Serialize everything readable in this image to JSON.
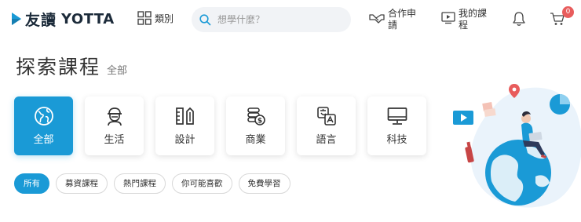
{
  "header": {
    "logo_cn": "友讀",
    "logo_en": "YOTTA",
    "category_label": "類別",
    "search_placeholder": "想學什麼？",
    "nav": {
      "cooperate": "合作申請",
      "my_courses": "我的課程"
    },
    "cart_count": "0"
  },
  "page": {
    "title": "探索課程",
    "subtitle": "全部"
  },
  "categories": [
    {
      "label": "全部",
      "icon": "globe-icon"
    },
    {
      "label": "生活",
      "icon": "person-icon"
    },
    {
      "label": "設計",
      "icon": "ruler-pencil-icon"
    },
    {
      "label": "商業",
      "icon": "coins-icon"
    },
    {
      "label": "語言",
      "icon": "translate-icon"
    },
    {
      "label": "科技",
      "icon": "monitor-icon"
    }
  ],
  "filters": [
    "所有",
    "募資課程",
    "熱門課程",
    "你可能喜歡",
    "免費學習"
  ],
  "colors": {
    "accent": "#1a9ad6",
    "badge": "#e85c5c",
    "text": "#333333"
  }
}
